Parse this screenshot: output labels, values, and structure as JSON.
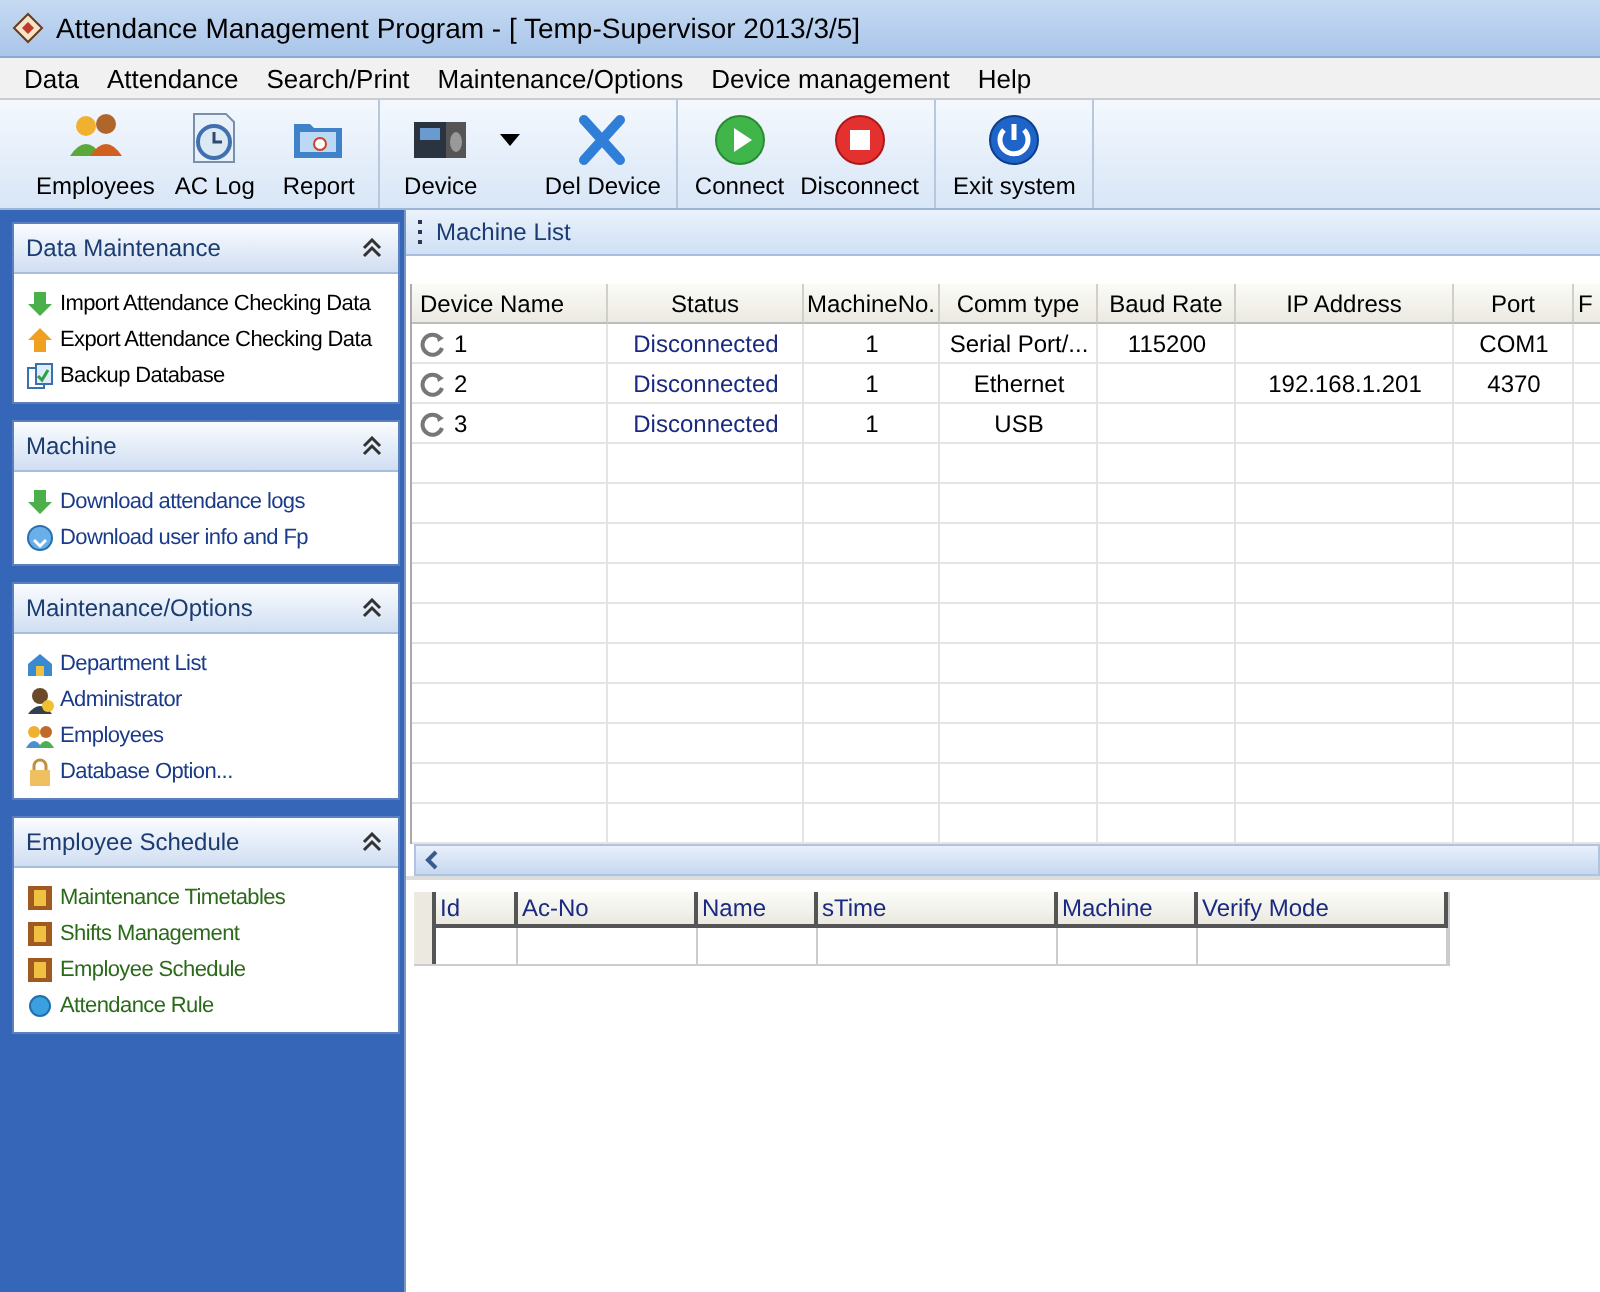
{
  "window": {
    "title": "Attendance Management Program - [ Temp-Supervisor 2013/3/5]"
  },
  "menu": [
    "Data",
    "Attendance",
    "Search/Print",
    "Maintenance/Options",
    "Device management",
    "Help"
  ],
  "toolbar": [
    [
      {
        "label": "Employees",
        "dropdown": false
      },
      {
        "label": "AC Log",
        "dropdown": false
      },
      {
        "label": "Report",
        "dropdown": false
      }
    ],
    [
      {
        "label": "Device",
        "dropdown": true
      },
      {
        "label": "Del Device",
        "dropdown": false
      }
    ],
    [
      {
        "label": "Connect",
        "dropdown": false
      },
      {
        "label": "Disconnect",
        "dropdown": false
      }
    ],
    [
      {
        "label": "Exit system",
        "dropdown": false
      }
    ]
  ],
  "sidebar": [
    {
      "title": "Data Maintenance",
      "expanded": true,
      "items": [
        "Import Attendance Checking Data",
        "Export Attendance Checking Data",
        "Backup Database"
      ]
    },
    {
      "title": "Machine",
      "expanded": true,
      "items": [
        "Download attendance logs",
        "Download user info and Fp"
      ]
    },
    {
      "title": "Maintenance/Options",
      "expanded": true,
      "items": [
        "Department List",
        "Administrator",
        "Employees",
        "Database Option..."
      ]
    },
    {
      "title": "Employee Schedule",
      "expanded": true,
      "items": [
        "Maintenance Timetables",
        "Shifts Management",
        "Employee Schedule",
        "Attendance Rule"
      ]
    }
  ],
  "machine_list": {
    "title": "Machine List",
    "columns": [
      "Device Name",
      "Status",
      "MachineNo.",
      "Comm type",
      "Baud Rate",
      "IP Address",
      "Port",
      "F"
    ],
    "rows": [
      [
        "1",
        "Disconnected",
        "1",
        "Serial Port/...",
        "115200",
        "",
        "COM1"
      ],
      [
        "2",
        "Disconnected",
        "1",
        "Ethernet",
        "",
        "192.168.1.201",
        "4370"
      ],
      [
        "3",
        "Disconnected",
        "1",
        "USB",
        "",
        "",
        ""
      ]
    ]
  },
  "log_table": {
    "columns": [
      "Id",
      "Ac-No",
      "Name",
      "sTime",
      "Machine",
      "Verify Mode"
    ]
  }
}
